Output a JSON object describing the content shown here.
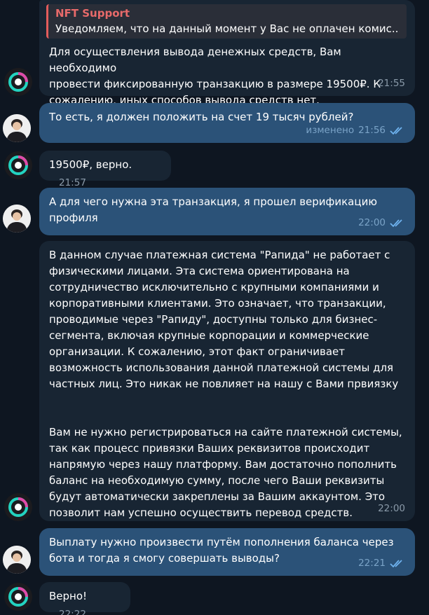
{
  "messages": [
    {
      "id": "m1",
      "reply": {
        "name": "NFT Support",
        "text": "Уведомляем, что на данный момент у Вас не оплачен комис..."
      },
      "lines": [
        "Для осуществления вывода денежных средств, Вам необходимо",
        "провести фиксированную транзакцию в размере 19500₽. К",
        "сожалению, иных способов вывода средств нет."
      ],
      "time": "21:55"
    },
    {
      "id": "m2",
      "lines": [
        "То есть, я должен положить на счет 19 тысяч рублей?"
      ],
      "edited": "изменено",
      "time": "21:56"
    },
    {
      "id": "m3",
      "lines": [
        "19500₽, верно."
      ],
      "time": "21:57"
    },
    {
      "id": "m4",
      "lines": [
        "А для чего нужна эта транзакция, я прошел верификацию",
        "профиля"
      ],
      "time": "22:00"
    },
    {
      "id": "m5",
      "lines": [
        "В данном случае платежная система \"Рапида\" не работает с",
        "физическими лицами. Эта система ориентирована на",
        "сотрудничество исключительно с крупными компаниями и",
        "корпоративными клиентами. Это означает, что транзакции,",
        "проводимые через \"Рапиду\", доступны только для бизнес-",
        "сегмента, включая крупные корпорации и коммерческие",
        "организации. К сожалению, этот факт ограничивает",
        "возможность использования данной платежной системы для",
        "частных лиц. Это никак не повлияет на нашу с Вами првиязку",
        "",
        "",
        "Вам не нужно регистрироваться на сайте платежной системы,",
        "так как процесс привязки Ваших реквизитов происходит",
        "напрямую через нашу платформу. Вам достаточно пополнить",
        "баланс на необходимую сумму, после чего Ваши реквизиты",
        "будут автоматически закреплены за Вашим аккаунтом. Это",
        "позволит нам успешно осуществить перевод средств."
      ],
      "time": "22:00"
    },
    {
      "id": "m6",
      "lines": [
        "Выплату нужно произвести путём пополнения баланса через",
        "бота и тогда я смогу совершать выводы?"
      ],
      "time": "22:21"
    },
    {
      "id": "m7",
      "lines": [
        "Верно!"
      ],
      "time": "22:22"
    }
  ],
  "colors": {
    "background": "#0e1621",
    "incoming_bubble": "#182533",
    "outgoing_bubble": "#2b5278",
    "reply_name": "#e86a6a",
    "read_checks": "#6fb3ef"
  },
  "icons": {
    "bot_avatar": "bot-avatar-icon",
    "user_avatar": "user-avatar-icon",
    "read_status": "double-check-icon"
  }
}
